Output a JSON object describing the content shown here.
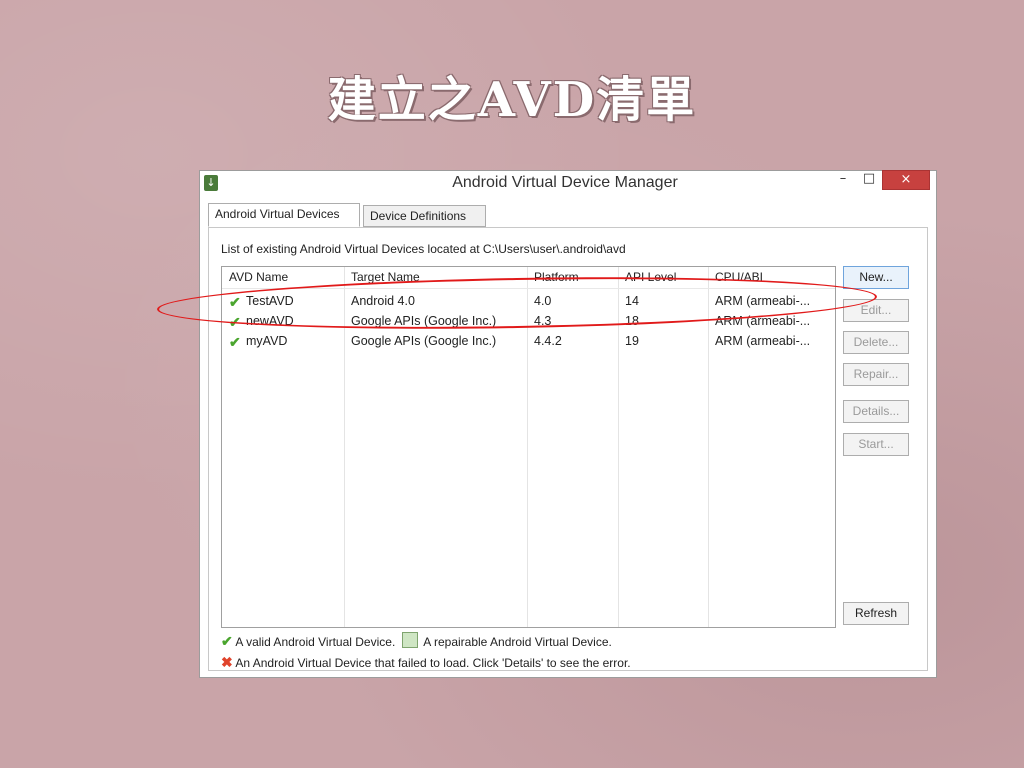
{
  "slide": {
    "title": "建立之AVD清單"
  },
  "window": {
    "title": "Android Virtual Device Manager",
    "controls": {
      "minimize": "–",
      "maximize": "□",
      "close": "×"
    }
  },
  "tabs": [
    {
      "label": "Android Virtual Devices",
      "active": true
    },
    {
      "label": "Device Definitions",
      "active": false
    }
  ],
  "panel": {
    "location_text": "List of existing Android Virtual Devices located at C:\\Users\\user\\.android\\avd"
  },
  "table": {
    "columns": [
      "AVD Name",
      "Target Name",
      "Platform",
      "API Level",
      "CPU/ABI"
    ],
    "rows": [
      {
        "status_icon": "check-icon",
        "name": "TestAVD",
        "target": "Android 4.0",
        "platform": "4.0",
        "api": "14",
        "cpu": "ARM (armeabi-..."
      },
      {
        "status_icon": "check-icon",
        "name": "newAVD",
        "target": "Google APIs (Google Inc.)",
        "platform": "4.3",
        "api": "18",
        "cpu": "ARM (armeabi-..."
      },
      {
        "status_icon": "check-icon",
        "name": "myAVD",
        "target": "Google APIs (Google Inc.)",
        "platform": "4.4.2",
        "api": "19",
        "cpu": "ARM (armeabi-..."
      }
    ]
  },
  "buttons": {
    "new": "New...",
    "edit": "Edit...",
    "delete": "Delete...",
    "repair": "Repair...",
    "details": "Details...",
    "start": "Start...",
    "refresh": "Refresh"
  },
  "legend": {
    "valid": "A valid Android Virtual Device.",
    "repairable": "A repairable Android Virtual Device.",
    "failed": "An Android Virtual Device that failed to load. Click 'Details' to see the error."
  },
  "colors": {
    "accent_check": "#4aa52e",
    "error_x": "#e0432b",
    "annotation": "#e11a1a",
    "close_button": "#c7413f"
  }
}
